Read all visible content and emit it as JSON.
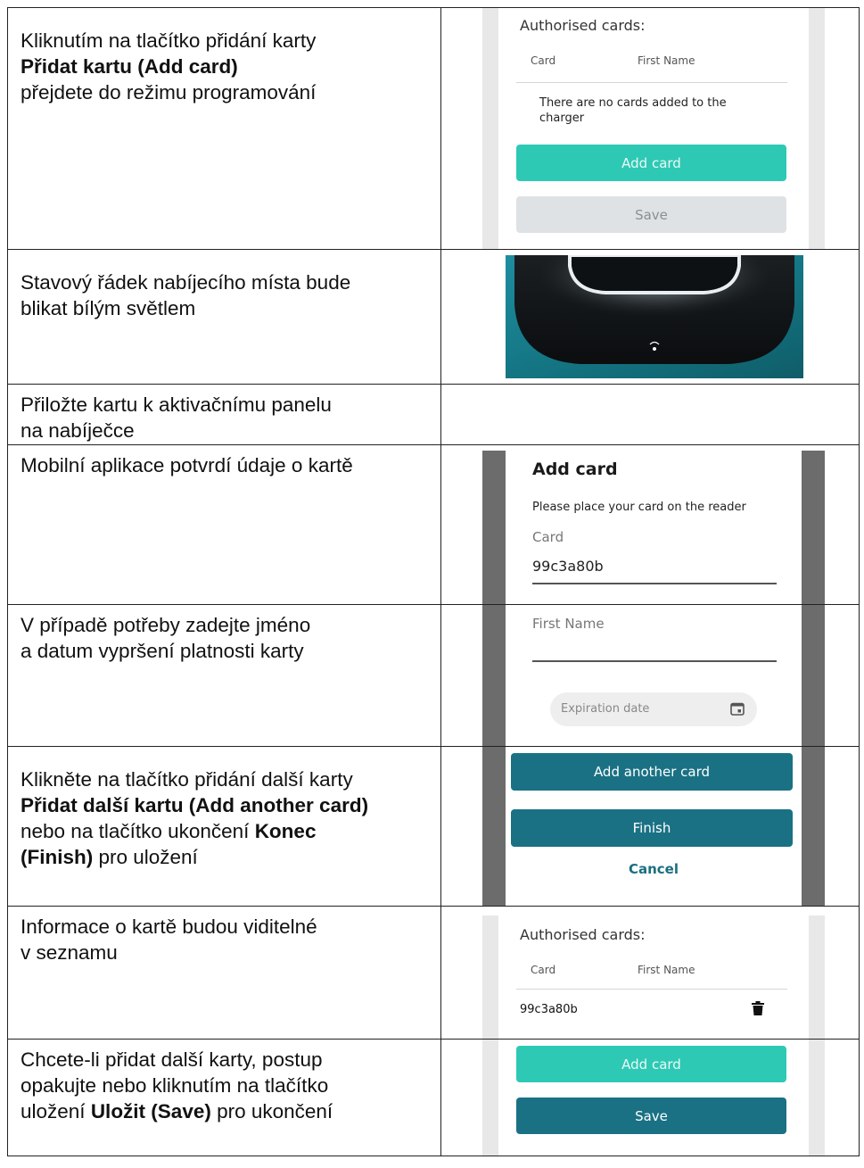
{
  "rows": [
    {
      "instruction": {
        "line1": "Kliknutím na tlačítko přidání karty",
        "line2_bold": "Přidat kartu (Add card)",
        "line3": "přejdete do režimu programování"
      },
      "panel": {
        "heading": "Authorised cards:",
        "col_card": "Card",
        "col_first_name": "First Name",
        "empty_message_1": "There are no cards added to the",
        "empty_message_2": "charger",
        "add_card_button": "Add card",
        "save_button": "Save"
      }
    },
    {
      "instruction": {
        "line1": "Stavový řádek nabíjecího místa bude",
        "line2": "blikat bílým světlem"
      }
    },
    {
      "instruction": {
        "line1": "Přiložte kartu k aktivačnímu panelu",
        "line2": "na nabíječce"
      }
    },
    {
      "instruction": {
        "line1": "Mobilní aplikace potvrdí údaje o kartě"
      },
      "panel": {
        "title": "Add card",
        "prompt": "Please place your card on the reader",
        "field_label": "Card",
        "field_value": "99c3a80b"
      }
    },
    {
      "instruction": {
        "line1": "V případě potřeby zadejte jméno",
        "line2": "a datum vypršení platnosti karty"
      },
      "panel": {
        "first_name_label": "First Name",
        "expiration_placeholder": "Expiration date"
      }
    },
    {
      "instruction": {
        "line1": "Klikněte na tlačítko přidání další karty",
        "line2_bold": "Přidat další kartu (Add another card)",
        "line3_prefix": "nebo na tlačítko ukončení ",
        "line3_bold": "Konec",
        "line4_bold": "(Finish)",
        "line4_suffix": " pro uložení"
      },
      "panel": {
        "add_another_button": "Add another card",
        "finish_button": "Finish",
        "cancel_link": "Cancel"
      }
    },
    {
      "instruction": {
        "line1": "Informace o kartě budou viditelné",
        "line2": "v seznamu"
      },
      "panel": {
        "heading": "Authorised cards:",
        "col_card": "Card",
        "col_first_name": "First Name",
        "card_id": "99c3a80b"
      }
    },
    {
      "instruction": {
        "line1": "Chcete-li přidat další karty, postup",
        "line2": "opakujte nebo kliknutím na tlačítko",
        "line3_prefix": "uložení ",
        "line3_bold": "Uložit (Save)",
        "line3_suffix": " pro ukončení"
      },
      "panel": {
        "add_card_button": "Add card",
        "save_button": "Save"
      }
    }
  ],
  "colors": {
    "teal_light": "#2ec9b5",
    "teal_dark": "#1a7184",
    "button_grey": "#dfe2e4"
  }
}
